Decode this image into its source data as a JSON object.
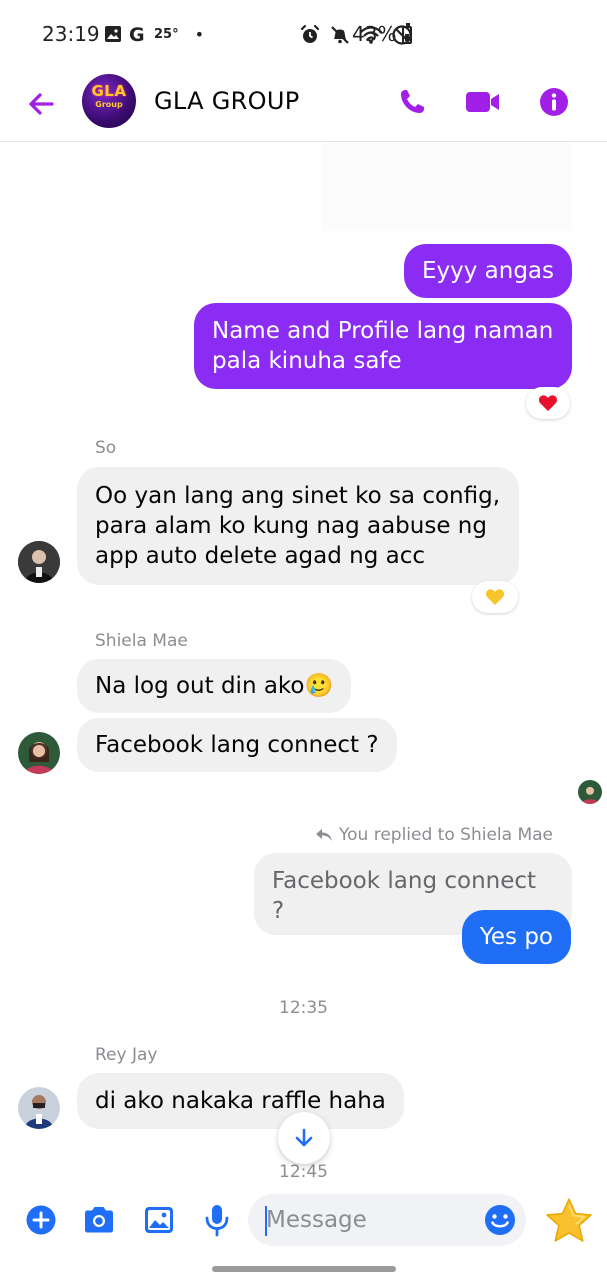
{
  "status_bar": {
    "time": "23:19",
    "temperature": "25°",
    "battery_percent": "43%",
    "dot": "•"
  },
  "header": {
    "title": "GLA GROUP",
    "avatar_text_main": "GLA",
    "avatar_text_sub": "Group",
    "accent_color": "#a11fe6"
  },
  "messages": {
    "out_1": "Eyyy angas",
    "out_2": "Name and Profile lang naman pala kinuha safe",
    "out_2_reaction": "❤️",
    "sender_so": "So",
    "so_msg": "Oo yan lang ang sinet ko sa config, para alam ko kung nag aabuse ng app auto delete agad ng acc",
    "so_reaction": "💛",
    "sender_sheila": "Shiela Mae",
    "sheila_msg_1": "Na log out din ako🥲",
    "sheila_msg_2": "Facebook lang connect ?",
    "replied_label": "You replied to Shiela Mae",
    "quoted_msg": "Facebook lang connect ?",
    "reply_msg": "Yes po",
    "time_1": "12:35",
    "sender_rey": "Rey Jay",
    "rey_msg": "di ako nakaka raffle haha",
    "time_2": "12:45"
  },
  "composer": {
    "placeholder": "Message"
  },
  "colors": {
    "outgoing_bubble": "#8b2cf5",
    "reply_bubble": "#1f6ef5",
    "incoming_bubble": "#f0f0f0",
    "composer_icons": "#1f6ef5"
  }
}
